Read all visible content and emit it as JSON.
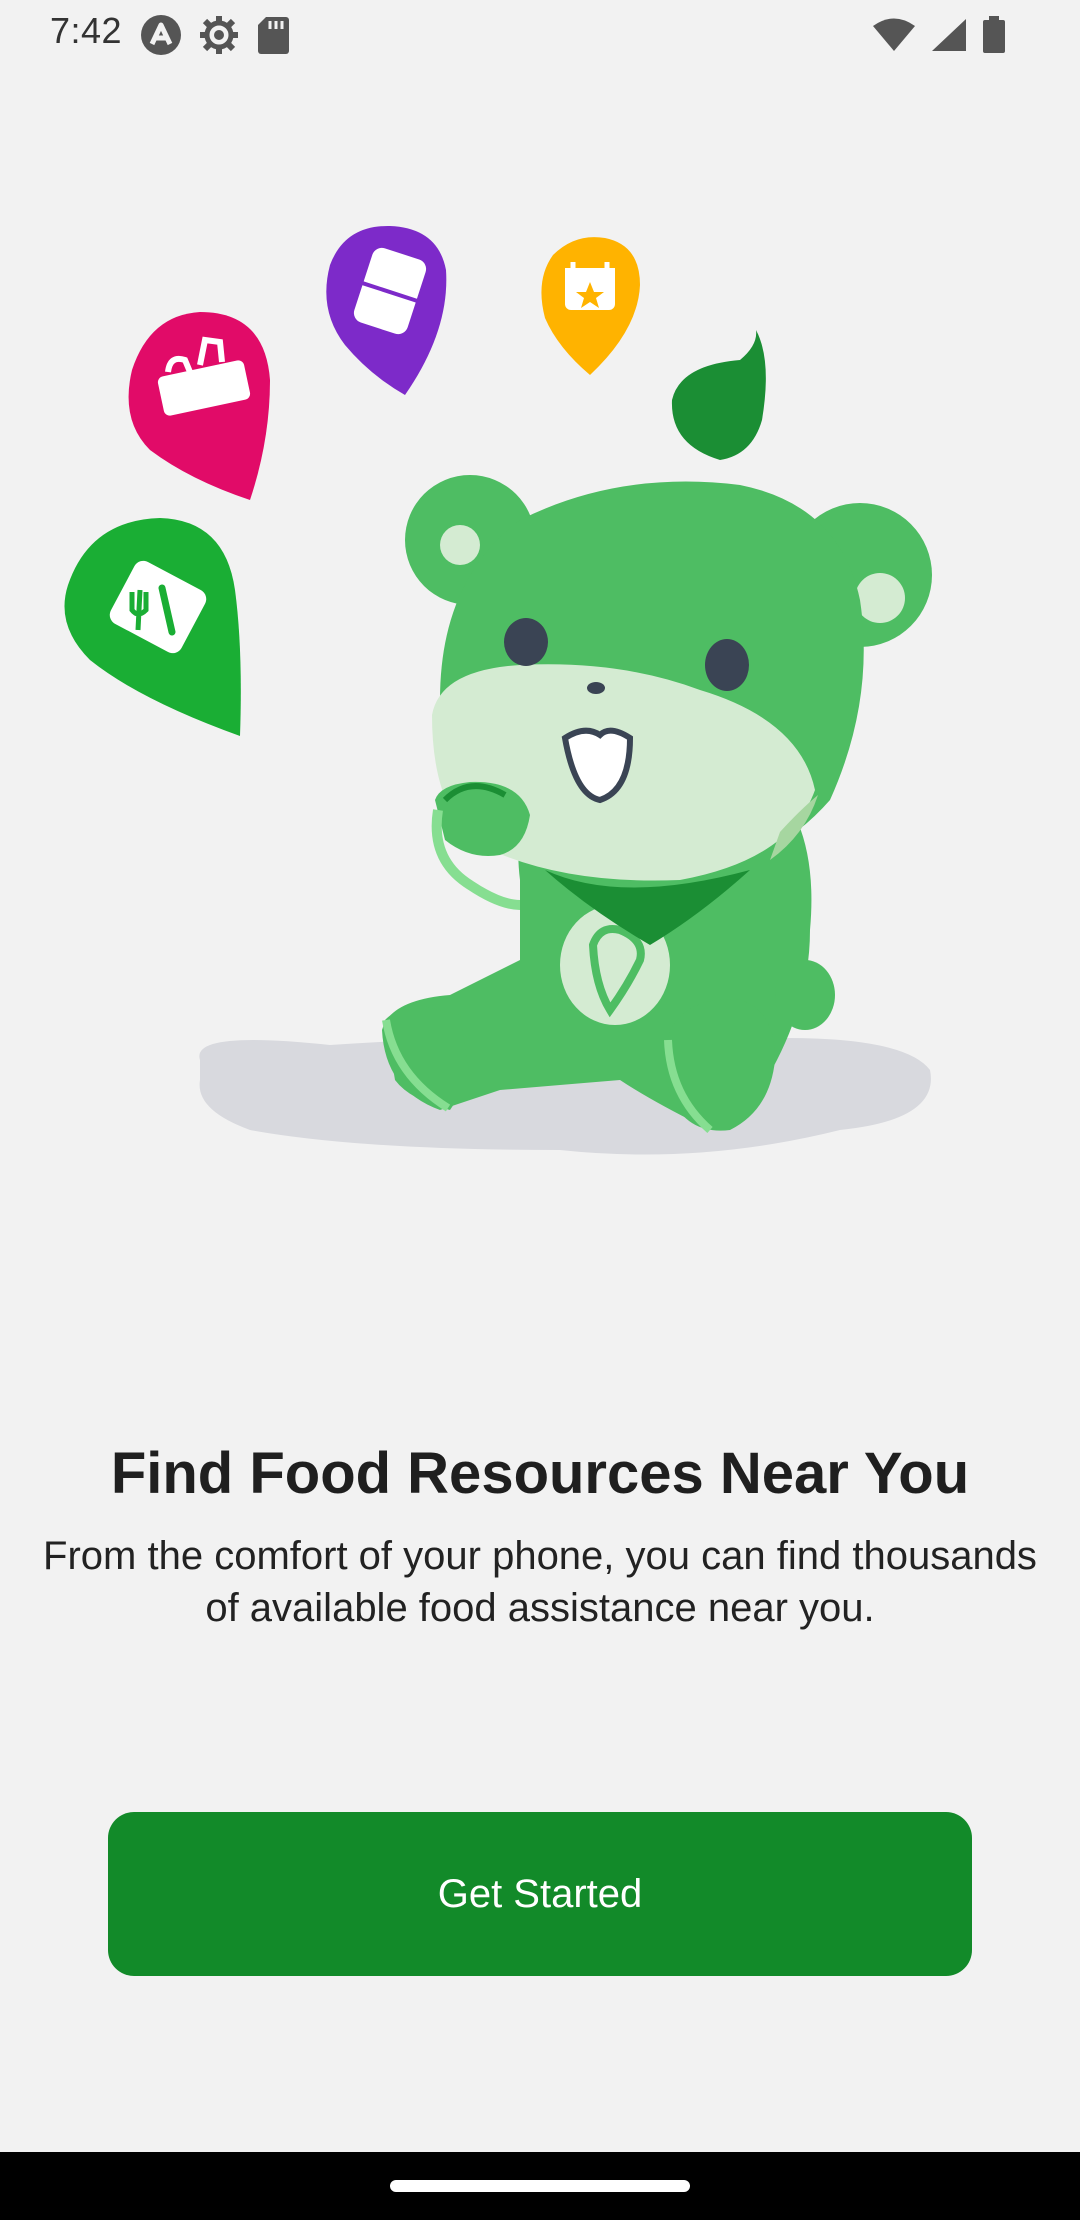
{
  "status_bar": {
    "time": "7:42"
  },
  "onboarding": {
    "title": "Find Food Resources Near You",
    "subtitle": "From the comfort of your phone, you can find thousands of available food assistance near you.",
    "cta_label": "Get Started"
  },
  "colors": {
    "background": "#f2f2f2",
    "primary": "#128a29",
    "bear_green": "#4ebd63",
    "pin_green": "#1aae34",
    "pin_pink": "#e10b68",
    "pin_purple": "#7d2ac9",
    "pin_yellow": "#ffb300"
  },
  "icons": [
    "android-debug-icon",
    "settings-gear-icon",
    "sd-card-icon",
    "wifi-icon",
    "cellular-signal-icon",
    "battery-icon"
  ]
}
